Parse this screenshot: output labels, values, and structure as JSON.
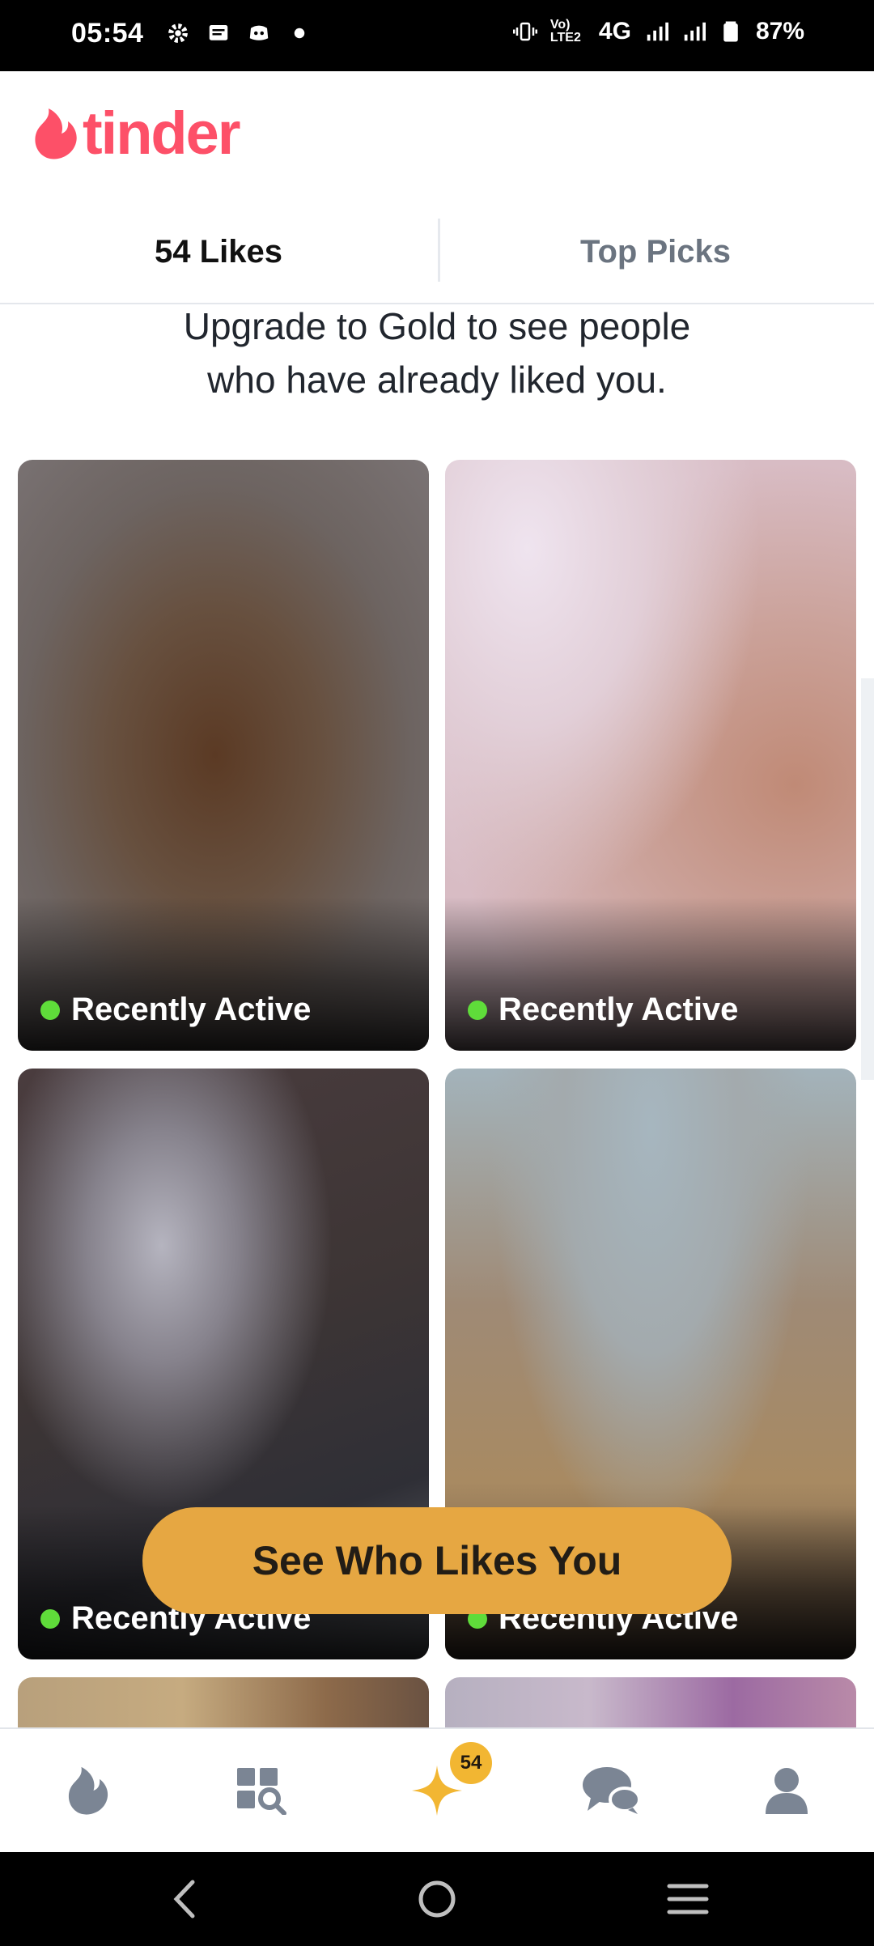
{
  "status_bar": {
    "time": "05:54",
    "network": "4G",
    "volte": "Vo) LTE2",
    "battery": "87%",
    "icons": [
      "gear-icon",
      "message-icon",
      "discord-icon",
      "dot-icon",
      "vibrate-icon",
      "signal-icon",
      "battery-icon"
    ]
  },
  "header": {
    "logo_text": "tinder",
    "brand_color": "#fd5068"
  },
  "tabs": [
    {
      "label": "54 Likes",
      "active": true
    },
    {
      "label": "Top Picks",
      "active": false
    }
  ],
  "upsell": {
    "line1": "Upgrade to Gold to see people",
    "line2": "who have already liked you."
  },
  "cards": [
    {
      "status": "Recently Active"
    },
    {
      "status": "Recently Active"
    },
    {
      "status": "Recently Active"
    },
    {
      "status": "Recently Active"
    }
  ],
  "cta": {
    "label": "See Who Likes You",
    "color": "#e6a742"
  },
  "bottom_nav": {
    "items": [
      "flame-icon",
      "explore-icon",
      "likes-sparkle-icon",
      "chat-icon",
      "profile-icon"
    ],
    "badge": "54"
  },
  "system_nav": [
    "back-icon",
    "home-icon",
    "recents-icon"
  ]
}
